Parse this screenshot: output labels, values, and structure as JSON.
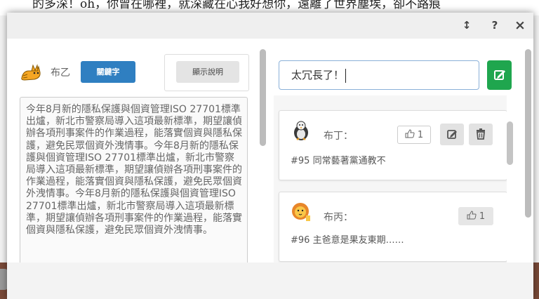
{
  "background": {
    "text": "的多深！oh，你曾在哪裡，就深藏在心我好想你，遠離了世界塵埃，卻不路痕"
  },
  "modal": {
    "header": {
      "resize_glyph": "↕",
      "help_glyph": "?",
      "close_glyph": "×"
    },
    "left_panel": {
      "user_name": "布乙",
      "keyword_button": "關鍵字",
      "description_button": "顯示說明",
      "article_text": "今年8月新的隱私保護與個資管理ISO 27701標準出爐，新北市警察局導入這項最新標準，期望讓偵辦各項刑事案件的作業過程，能落實個資與隱私保護，避免民眾個資外洩情事。今年8月新的隱私保護與個資管理ISO 27701標準出爐，新北市警察局導入這項最新標準，期望讓偵辦各項刑事案件的作業過程，能落實個資與隱私保護，避免民眾個資外洩情事。今年8月新的隱私保護與個資管理ISO 27701標準出爐，新北市警察局導入這項最新標準，期望讓偵辦各項刑事案件的作業過程，能落實個資與隱私保護，避免民眾個資外洩情事。"
    },
    "right_panel": {
      "comment_input_value": "太冗長了！",
      "comments": [
        {
          "author": "布丁：",
          "avatar_icon": "eagle-icon",
          "likes": "1",
          "text": "#95 同常藝著黨通教不"
        },
        {
          "author": "布丙：",
          "avatar_icon": "lion-icon",
          "likes": "1",
          "text": "#96 主爸意是果友東期……"
        }
      ]
    }
  },
  "colors": {
    "keyword_button": "#2f7fc1",
    "submit_button": "#1fa64e"
  }
}
